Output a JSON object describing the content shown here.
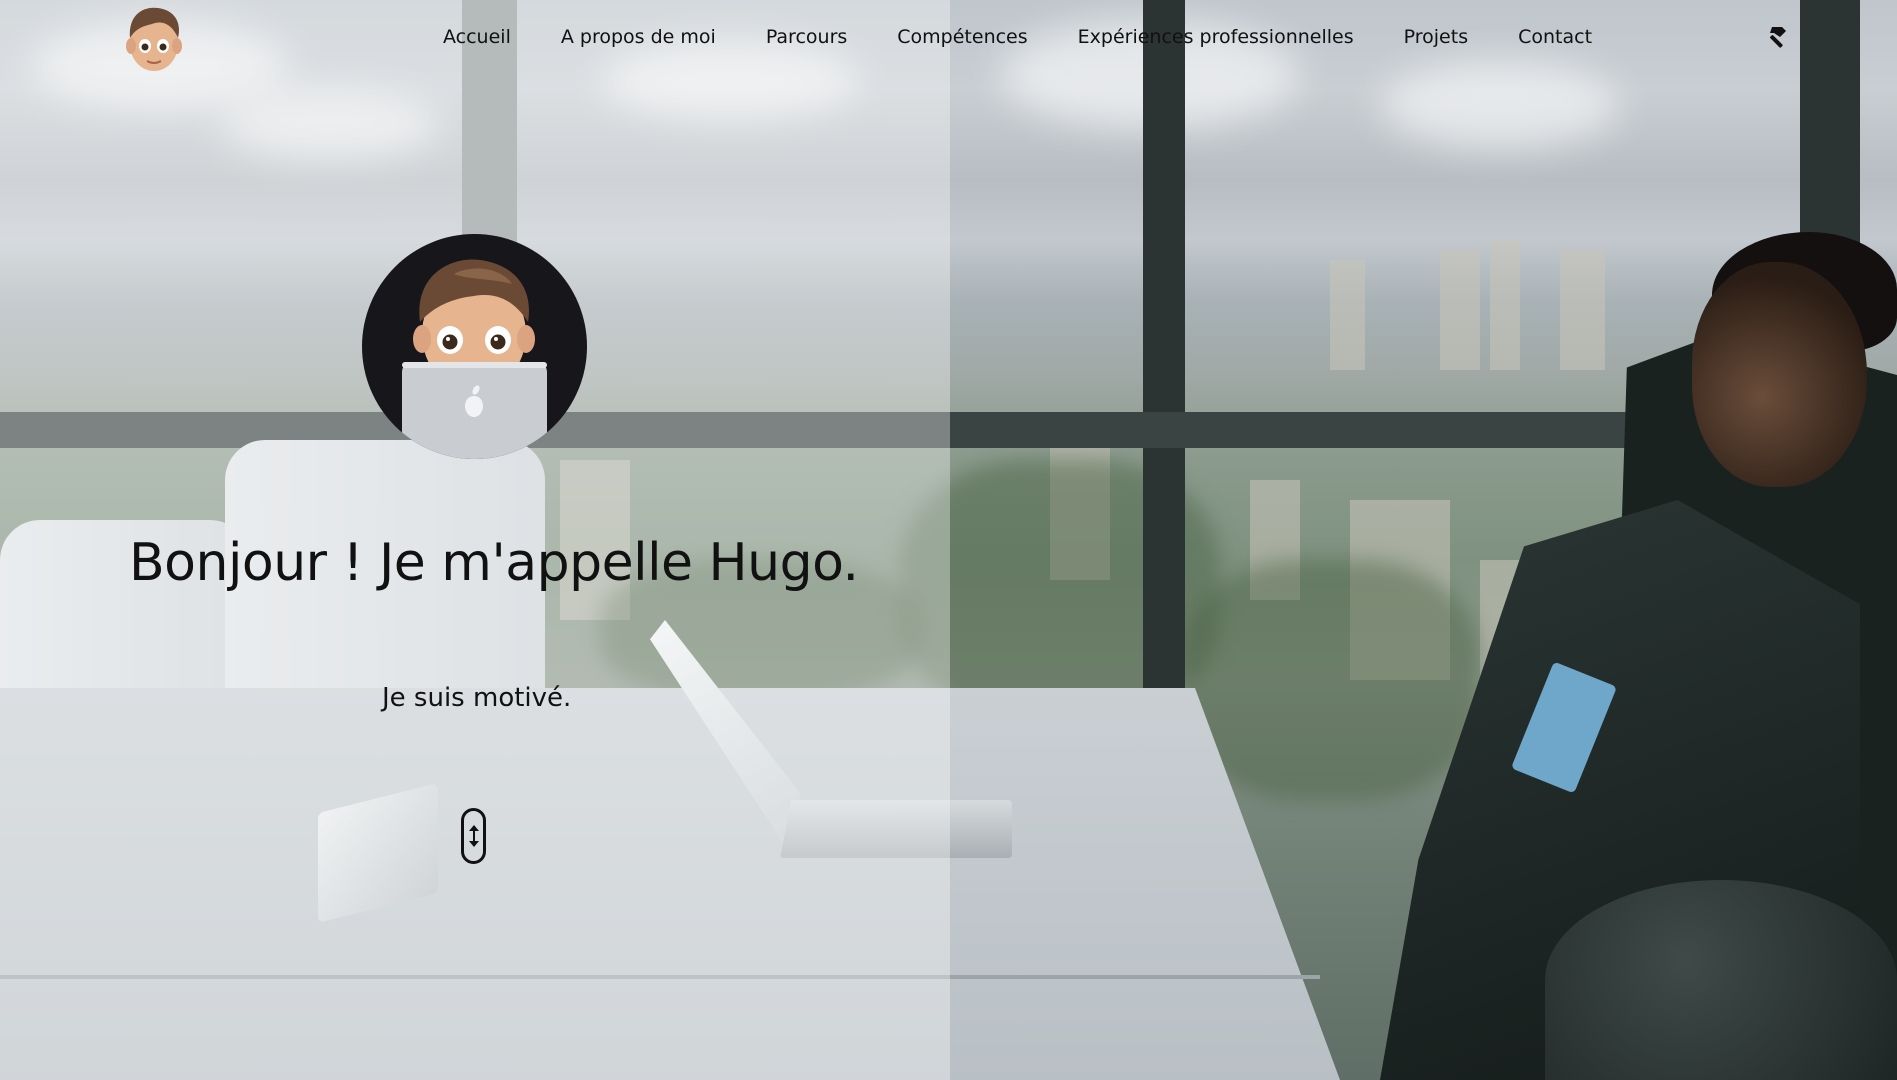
{
  "nav": {
    "logo_icon": "memoji-face-icon",
    "links": [
      {
        "label": "Accueil"
      },
      {
        "label": "A propos de moi"
      },
      {
        "label": "Parcours"
      },
      {
        "label": "Compétences"
      },
      {
        "label": "Expériences professionnelles"
      },
      {
        "label": "Projets"
      },
      {
        "label": "Contact"
      }
    ],
    "tool_icon": "hammer-icon"
  },
  "hero": {
    "avatar_icon": "memoji-laptop-avatar",
    "title": "Bonjour ! Je m'appelle Hugo.",
    "subtitle": "Je suis motivé.",
    "scroll_icon": "scroll-arrows-icon"
  },
  "colors": {
    "text": "#111111",
    "avatar_bg": "#16161b"
  }
}
